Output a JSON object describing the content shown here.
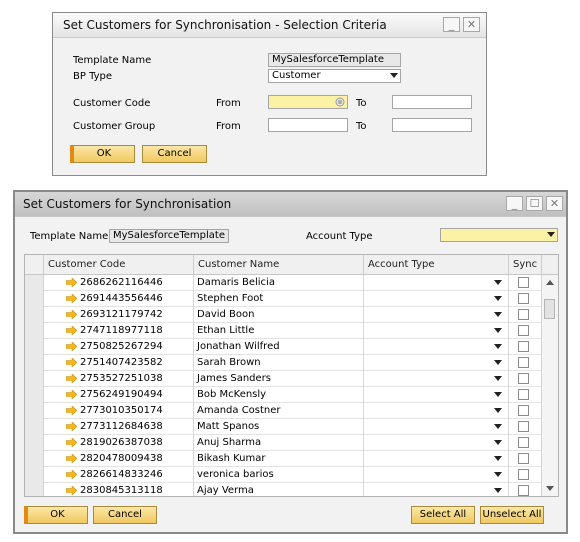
{
  "criteria_dialog": {
    "title": "Set Customers for Synchronisation - Selection Criteria",
    "template_name_label": "Template Name",
    "template_name_value": "MySalesforceTemplate",
    "bp_type_label": "BP Type",
    "bp_type_value": "Customer",
    "customer_code_label": "Customer Code",
    "customer_group_label": "Customer Group",
    "from_label": "From",
    "to_label": "To",
    "ok_label": "OK",
    "cancel_label": "Cancel",
    "minimize_glyph": "_",
    "close_glyph": "✕"
  },
  "sync_window": {
    "title": "Set Customers for Synchronisation",
    "template_name_label": "Template Name",
    "template_name_value": "MySalesforceTemplate",
    "account_type_label": "Account Type",
    "columns": [
      "Customer Code",
      "Customer Name",
      "Account Type",
      "Sync"
    ],
    "rows": [
      {
        "code": "2686262116446",
        "name": "Damaris Belicia"
      },
      {
        "code": "2691443556446",
        "name": "Stephen Foot"
      },
      {
        "code": "2693121179742",
        "name": "David Boon"
      },
      {
        "code": "2747118977118",
        "name": "Ethan Little"
      },
      {
        "code": "2750825267294",
        "name": "Jonathan Wilfred"
      },
      {
        "code": "2751407423582",
        "name": "Sarah Brown"
      },
      {
        "code": "2753527251038",
        "name": "James Sanders"
      },
      {
        "code": "2756249190494",
        "name": "Bob McKensly"
      },
      {
        "code": "2773010350174",
        "name": "Amanda Costner"
      },
      {
        "code": "2773112684638",
        "name": "Matt Spanos"
      },
      {
        "code": "2819026387038",
        "name": "Anuj Sharma"
      },
      {
        "code": "2820478009438",
        "name": "Bikash Kumar"
      },
      {
        "code": "2826614833246",
        "name": "veronica barios"
      },
      {
        "code": "2830845313118",
        "name": "Ajay Verma"
      }
    ],
    "ok_label": "OK",
    "cancel_label": "Cancel",
    "select_all_label": "Select All",
    "unselect_all_label": "Unselect All",
    "minimize_glyph": "_",
    "maximize_glyph": "☐",
    "close_glyph": "✕"
  },
  "colors": {
    "link_arrow": "#f2b81c",
    "highlight_field": "#fbf2a6",
    "button": "#f0c860",
    "default_button_marker": "#e38a16"
  }
}
